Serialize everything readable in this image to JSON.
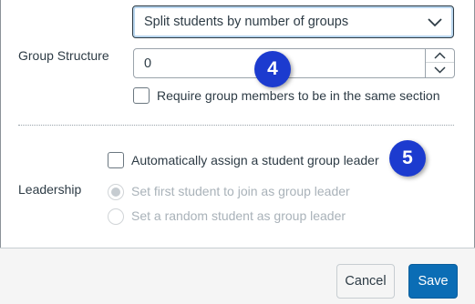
{
  "group_structure": {
    "label": "Group Structure",
    "split_select": {
      "value": "Split students by number of groups"
    },
    "group_count": {
      "value": "0"
    },
    "same_section": {
      "label": "Require group members to be in the same section",
      "checked": false
    }
  },
  "leadership": {
    "label": "Leadership",
    "auto_assign": {
      "label": "Automatically assign a student group leader",
      "checked": false
    },
    "options": [
      {
        "label": "Set first student to join as group leader",
        "selected": true,
        "disabled": true
      },
      {
        "label": "Set a random student as group leader",
        "selected": false,
        "disabled": true
      }
    ]
  },
  "callouts": {
    "step_4": "4",
    "step_5": "5"
  },
  "footer": {
    "cancel_label": "Cancel",
    "save_label": "Save"
  },
  "colors": {
    "primary_button": "#0b6db5",
    "callout_badge": "#1c3bcf",
    "text": "#2d3b45",
    "disabled_text": "#a9b2b9"
  }
}
